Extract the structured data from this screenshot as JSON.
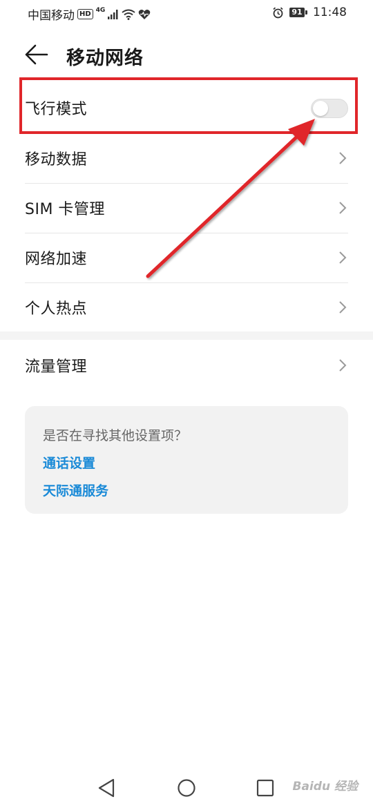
{
  "status_bar": {
    "carrier": "中国移动",
    "hd_badge": "HD",
    "network_type": "4G",
    "battery": "91",
    "time": "11:48",
    "icons": [
      "signal-icon",
      "wifi-icon",
      "heart-rate-icon",
      "alarm-icon",
      "battery-icon"
    ]
  },
  "header": {
    "title": "移动网络",
    "back_icon": "back-arrow-icon"
  },
  "list": {
    "items": [
      {
        "label": "飞行模式",
        "control": "toggle",
        "toggle_on": false
      },
      {
        "label": "移动数据",
        "control": "chevron"
      },
      {
        "label": "SIM 卡管理",
        "control": "chevron"
      },
      {
        "label": "网络加速",
        "control": "chevron"
      },
      {
        "label": "个人热点",
        "control": "chevron"
      }
    ],
    "section2": [
      {
        "label": "流量管理",
        "control": "chevron"
      }
    ]
  },
  "suggestions": {
    "title": "是否在寻找其他设置项？",
    "links": [
      "通话设置",
      "天际通服务"
    ]
  },
  "nav_bar": {
    "icons": [
      "back-triangle-icon",
      "home-circle-icon",
      "recents-square-icon"
    ]
  },
  "watermark": "Baidu 经验",
  "colors": {
    "accent_link": "#1a8ad7",
    "annotation_red": "#e0262a",
    "toggle_off": "#e9e9e9"
  }
}
